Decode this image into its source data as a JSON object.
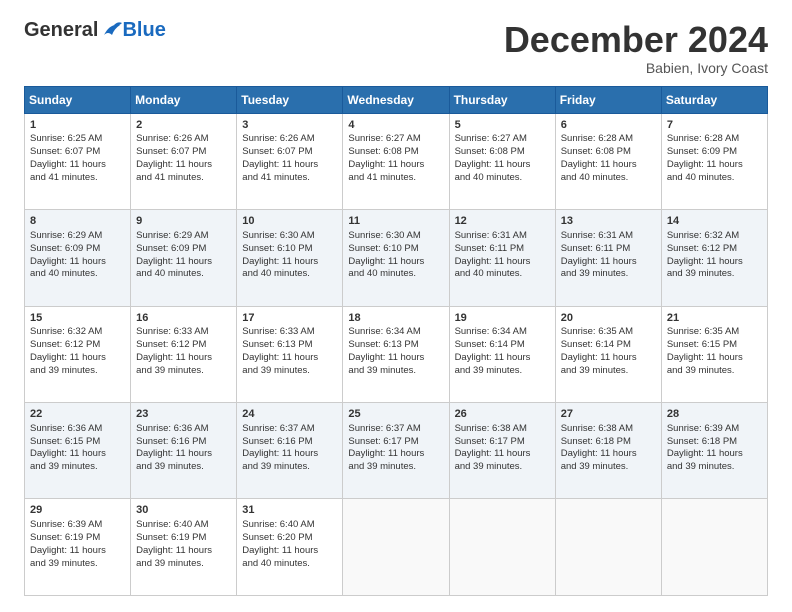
{
  "header": {
    "logo_general": "General",
    "logo_blue": "Blue",
    "month_title": "December 2024",
    "subtitle": "Babien, Ivory Coast"
  },
  "days_of_week": [
    "Sunday",
    "Monday",
    "Tuesday",
    "Wednesday",
    "Thursday",
    "Friday",
    "Saturday"
  ],
  "weeks": [
    [
      {
        "day": "1",
        "lines": [
          "Sunrise: 6:25 AM",
          "Sunset: 6:07 PM",
          "Daylight: 11 hours",
          "and 41 minutes."
        ]
      },
      {
        "day": "2",
        "lines": [
          "Sunrise: 6:26 AM",
          "Sunset: 6:07 PM",
          "Daylight: 11 hours",
          "and 41 minutes."
        ]
      },
      {
        "day": "3",
        "lines": [
          "Sunrise: 6:26 AM",
          "Sunset: 6:07 PM",
          "Daylight: 11 hours",
          "and 41 minutes."
        ]
      },
      {
        "day": "4",
        "lines": [
          "Sunrise: 6:27 AM",
          "Sunset: 6:08 PM",
          "Daylight: 11 hours",
          "and 41 minutes."
        ]
      },
      {
        "day": "5",
        "lines": [
          "Sunrise: 6:27 AM",
          "Sunset: 6:08 PM",
          "Daylight: 11 hours",
          "and 40 minutes."
        ]
      },
      {
        "day": "6",
        "lines": [
          "Sunrise: 6:28 AM",
          "Sunset: 6:08 PM",
          "Daylight: 11 hours",
          "and 40 minutes."
        ]
      },
      {
        "day": "7",
        "lines": [
          "Sunrise: 6:28 AM",
          "Sunset: 6:09 PM",
          "Daylight: 11 hours",
          "and 40 minutes."
        ]
      }
    ],
    [
      {
        "day": "8",
        "lines": [
          "Sunrise: 6:29 AM",
          "Sunset: 6:09 PM",
          "Daylight: 11 hours",
          "and 40 minutes."
        ]
      },
      {
        "day": "9",
        "lines": [
          "Sunrise: 6:29 AM",
          "Sunset: 6:09 PM",
          "Daylight: 11 hours",
          "and 40 minutes."
        ]
      },
      {
        "day": "10",
        "lines": [
          "Sunrise: 6:30 AM",
          "Sunset: 6:10 PM",
          "Daylight: 11 hours",
          "and 40 minutes."
        ]
      },
      {
        "day": "11",
        "lines": [
          "Sunrise: 6:30 AM",
          "Sunset: 6:10 PM",
          "Daylight: 11 hours",
          "and 40 minutes."
        ]
      },
      {
        "day": "12",
        "lines": [
          "Sunrise: 6:31 AM",
          "Sunset: 6:11 PM",
          "Daylight: 11 hours",
          "and 40 minutes."
        ]
      },
      {
        "day": "13",
        "lines": [
          "Sunrise: 6:31 AM",
          "Sunset: 6:11 PM",
          "Daylight: 11 hours",
          "and 39 minutes."
        ]
      },
      {
        "day": "14",
        "lines": [
          "Sunrise: 6:32 AM",
          "Sunset: 6:12 PM",
          "Daylight: 11 hours",
          "and 39 minutes."
        ]
      }
    ],
    [
      {
        "day": "15",
        "lines": [
          "Sunrise: 6:32 AM",
          "Sunset: 6:12 PM",
          "Daylight: 11 hours",
          "and 39 minutes."
        ]
      },
      {
        "day": "16",
        "lines": [
          "Sunrise: 6:33 AM",
          "Sunset: 6:12 PM",
          "Daylight: 11 hours",
          "and 39 minutes."
        ]
      },
      {
        "day": "17",
        "lines": [
          "Sunrise: 6:33 AM",
          "Sunset: 6:13 PM",
          "Daylight: 11 hours",
          "and 39 minutes."
        ]
      },
      {
        "day": "18",
        "lines": [
          "Sunrise: 6:34 AM",
          "Sunset: 6:13 PM",
          "Daylight: 11 hours",
          "and 39 minutes."
        ]
      },
      {
        "day": "19",
        "lines": [
          "Sunrise: 6:34 AM",
          "Sunset: 6:14 PM",
          "Daylight: 11 hours",
          "and 39 minutes."
        ]
      },
      {
        "day": "20",
        "lines": [
          "Sunrise: 6:35 AM",
          "Sunset: 6:14 PM",
          "Daylight: 11 hours",
          "and 39 minutes."
        ]
      },
      {
        "day": "21",
        "lines": [
          "Sunrise: 6:35 AM",
          "Sunset: 6:15 PM",
          "Daylight: 11 hours",
          "and 39 minutes."
        ]
      }
    ],
    [
      {
        "day": "22",
        "lines": [
          "Sunrise: 6:36 AM",
          "Sunset: 6:15 PM",
          "Daylight: 11 hours",
          "and 39 minutes."
        ]
      },
      {
        "day": "23",
        "lines": [
          "Sunrise: 6:36 AM",
          "Sunset: 6:16 PM",
          "Daylight: 11 hours",
          "and 39 minutes."
        ]
      },
      {
        "day": "24",
        "lines": [
          "Sunrise: 6:37 AM",
          "Sunset: 6:16 PM",
          "Daylight: 11 hours",
          "and 39 minutes."
        ]
      },
      {
        "day": "25",
        "lines": [
          "Sunrise: 6:37 AM",
          "Sunset: 6:17 PM",
          "Daylight: 11 hours",
          "and 39 minutes."
        ]
      },
      {
        "day": "26",
        "lines": [
          "Sunrise: 6:38 AM",
          "Sunset: 6:17 PM",
          "Daylight: 11 hours",
          "and 39 minutes."
        ]
      },
      {
        "day": "27",
        "lines": [
          "Sunrise: 6:38 AM",
          "Sunset: 6:18 PM",
          "Daylight: 11 hours",
          "and 39 minutes."
        ]
      },
      {
        "day": "28",
        "lines": [
          "Sunrise: 6:39 AM",
          "Sunset: 6:18 PM",
          "Daylight: 11 hours",
          "and 39 minutes."
        ]
      }
    ],
    [
      {
        "day": "29",
        "lines": [
          "Sunrise: 6:39 AM",
          "Sunset: 6:19 PM",
          "Daylight: 11 hours",
          "and 39 minutes."
        ]
      },
      {
        "day": "30",
        "lines": [
          "Sunrise: 6:40 AM",
          "Sunset: 6:19 PM",
          "Daylight: 11 hours",
          "and 39 minutes."
        ]
      },
      {
        "day": "31",
        "lines": [
          "Sunrise: 6:40 AM",
          "Sunset: 6:20 PM",
          "Daylight: 11 hours",
          "and 40 minutes."
        ]
      },
      null,
      null,
      null,
      null
    ]
  ]
}
